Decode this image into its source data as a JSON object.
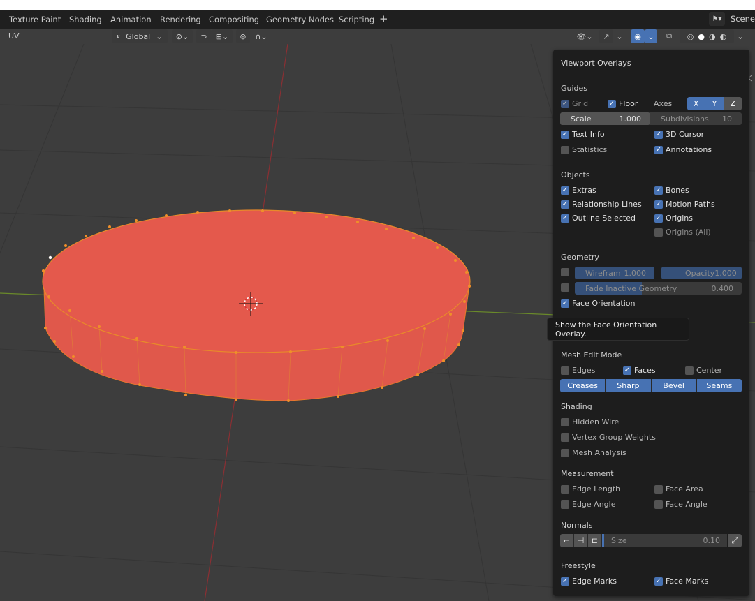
{
  "workspace_tabs": [
    "Texture Paint",
    "Shading",
    "Animation",
    "Rendering",
    "Compositing",
    "Geometry Nodes",
    "Scripting"
  ],
  "scene_label": "Scene",
  "header": {
    "mode_label": "UV",
    "orientation": "Global"
  },
  "overlays": {
    "title": "Viewport Overlays",
    "guides": {
      "title": "Guides",
      "grid": "Grid",
      "floor": "Floor",
      "axes_label": "Axes",
      "axes": [
        "X",
        "Y",
        "Z"
      ],
      "scale_label": "Scale",
      "scale_value": "1.000",
      "subdivisions_label": "Subdivisions",
      "subdivisions_value": "10",
      "text_info": "Text Info",
      "cursor_3d": "3D Cursor",
      "statistics": "Statistics",
      "annotations": "Annotations"
    },
    "objects": {
      "title": "Objects",
      "extras": "Extras",
      "bones": "Bones",
      "relationship_lines": "Relationship Lines",
      "motion_paths": "Motion Paths",
      "outline_selected": "Outline Selected",
      "origins": "Origins",
      "origins_all": "Origins (All)"
    },
    "geometry": {
      "title": "Geometry",
      "wireframe_label": "Wirefram",
      "wireframe_value": "1.000",
      "opacity_label": "Opacity",
      "opacity_value": "1.000",
      "fade_label": "Fade Inactive Geometry",
      "fade_value": "0.400",
      "face_orientation": "Face Orientation"
    },
    "tooltip": "Show the Face Orientation Overlay.",
    "mesh_edit": {
      "title": "Mesh Edit Mode",
      "edges": "Edges",
      "faces": "Faces",
      "center": "Center",
      "buttons": [
        "Creases",
        "Sharp",
        "Bevel",
        "Seams"
      ]
    },
    "shading": {
      "title": "Shading",
      "hidden_wire": "Hidden Wire",
      "vertex_group_weights": "Vertex Group Weights",
      "mesh_analysis": "Mesh Analysis"
    },
    "measurement": {
      "title": "Measurement",
      "edge_length": "Edge Length",
      "face_area": "Face Area",
      "edge_angle": "Edge Angle",
      "face_angle": "Face Angle"
    },
    "normals": {
      "title": "Normals",
      "size_label": "Size",
      "size_value": "0.10"
    },
    "freestyle": {
      "title": "Freestyle",
      "edge_marks": "Edge Marks",
      "face_marks": "Face Marks"
    }
  },
  "colors": {
    "accent": "#4772b3",
    "mesh_face": "#e4594c",
    "panel_bg": "#1d1d1d",
    "viewport_bg": "#3d3d3d"
  }
}
